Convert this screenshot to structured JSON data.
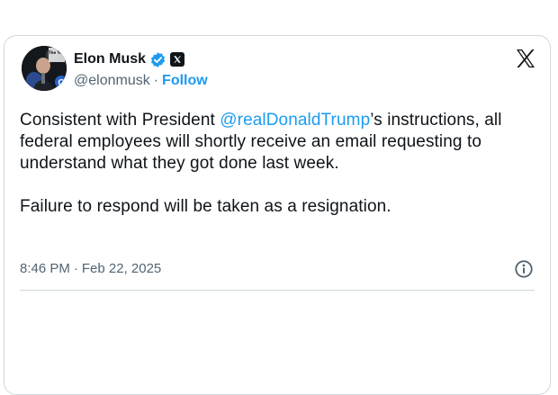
{
  "author": {
    "display_name": "Elon Musk",
    "handle": "@elonmusk",
    "separator": "·",
    "follow_label": "Follow",
    "avatar_badge_text": "The Yeti",
    "avatar_letter": "C",
    "verified_icon": "verified-badge-icon",
    "affiliate_icon": "x-affiliate-icon"
  },
  "brand": {
    "logo_icon": "x-logo-icon",
    "accent_color": "#1d9bf0",
    "text_color": "#0f1419",
    "muted_color": "#536471"
  },
  "tweet": {
    "text_part1": "Consistent with President ",
    "mention": "@realDonaldTrump",
    "text_part2": "’s instructions, all federal employees will shortly receive an email requesting to understand what they got done last week.",
    "text_paragraph2": "Failure to respond will be taken as a resignation."
  },
  "meta": {
    "time": "8:46 PM",
    "separator": "·",
    "date": "Feb 22, 2025",
    "info_icon": "info-icon"
  }
}
